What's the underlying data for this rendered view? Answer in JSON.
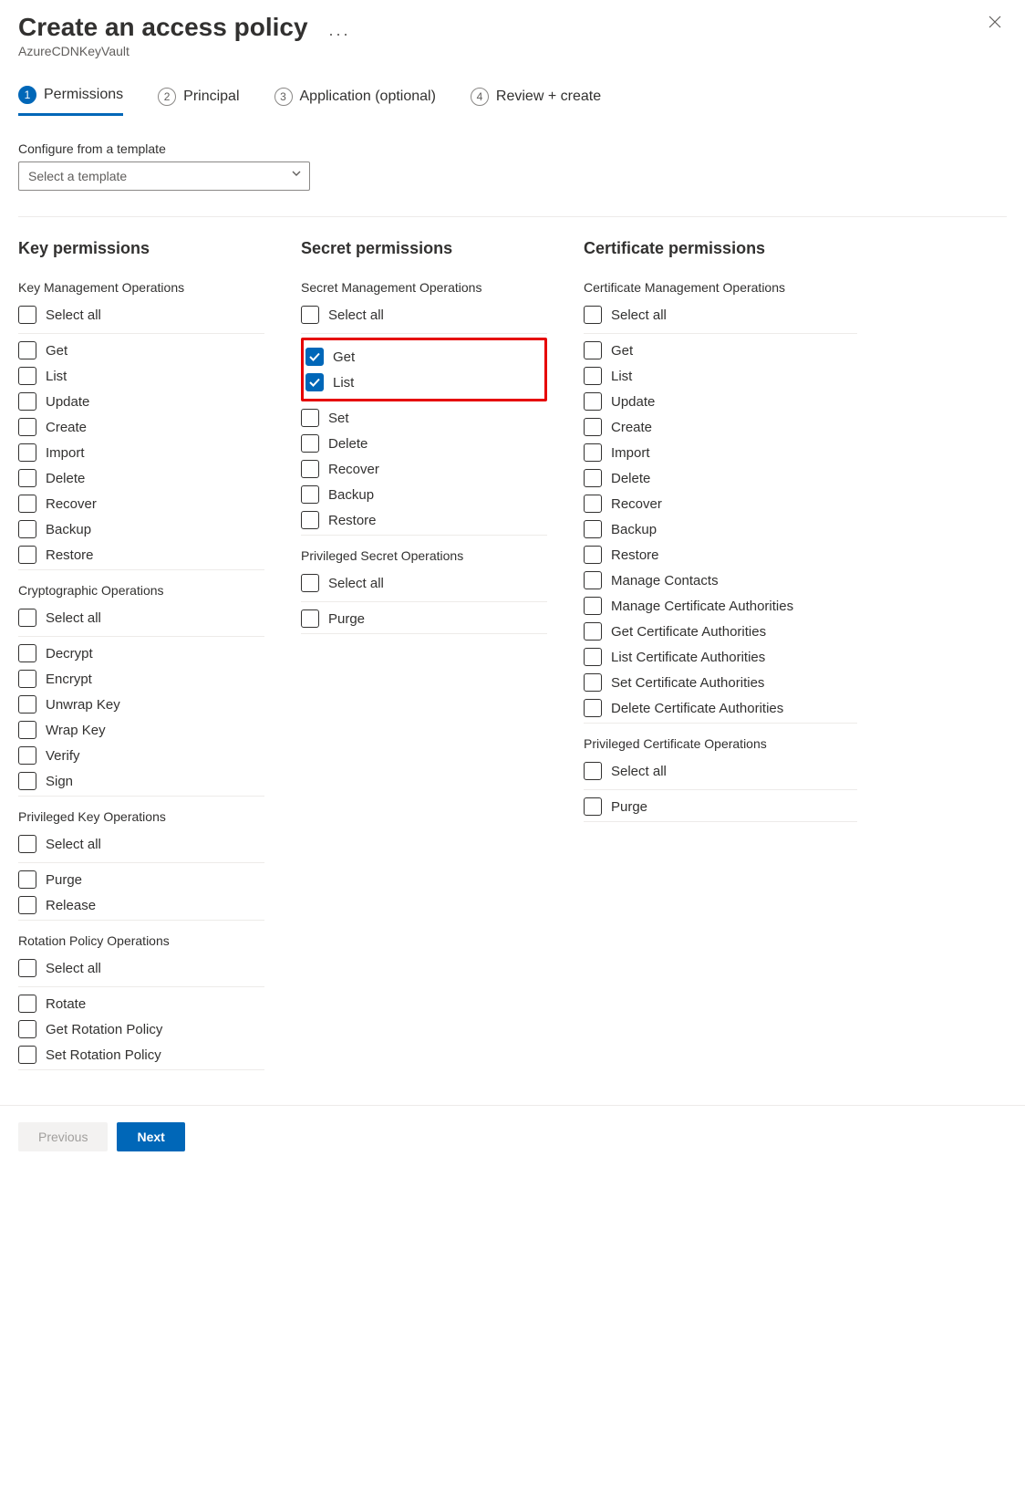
{
  "header": {
    "title": "Create an access policy",
    "subtitle": "AzureCDNKeyVault"
  },
  "tabs": [
    {
      "num": "1",
      "label": "Permissions",
      "active": true
    },
    {
      "num": "2",
      "label": "Principal",
      "active": false
    },
    {
      "num": "3",
      "label": "Application (optional)",
      "active": false
    },
    {
      "num": "4",
      "label": "Review + create",
      "active": false
    }
  ],
  "template": {
    "label": "Configure from a template",
    "placeholder": "Select a template"
  },
  "columns": [
    {
      "title": "Key permissions",
      "sections": [
        {
          "label": "Key Management Operations",
          "select_all": "Select all",
          "items": [
            {
              "label": "Get",
              "checked": false
            },
            {
              "label": "List",
              "checked": false
            },
            {
              "label": "Update",
              "checked": false
            },
            {
              "label": "Create",
              "checked": false
            },
            {
              "label": "Import",
              "checked": false
            },
            {
              "label": "Delete",
              "checked": false
            },
            {
              "label": "Recover",
              "checked": false
            },
            {
              "label": "Backup",
              "checked": false
            },
            {
              "label": "Restore",
              "checked": false
            }
          ]
        },
        {
          "label": "Cryptographic Operations",
          "select_all": "Select all",
          "items": [
            {
              "label": "Decrypt",
              "checked": false
            },
            {
              "label": "Encrypt",
              "checked": false
            },
            {
              "label": "Unwrap Key",
              "checked": false
            },
            {
              "label": "Wrap Key",
              "checked": false
            },
            {
              "label": "Verify",
              "checked": false
            },
            {
              "label": "Sign",
              "checked": false
            }
          ]
        },
        {
          "label": "Privileged Key Operations",
          "select_all": "Select all",
          "items": [
            {
              "label": "Purge",
              "checked": false
            },
            {
              "label": "Release",
              "checked": false
            }
          ]
        },
        {
          "label": "Rotation Policy Operations",
          "select_all": "Select all",
          "items": [
            {
              "label": "Rotate",
              "checked": false
            },
            {
              "label": "Get Rotation Policy",
              "checked": false
            },
            {
              "label": "Set Rotation Policy",
              "checked": false
            }
          ]
        }
      ]
    },
    {
      "title": "Secret permissions",
      "sections": [
        {
          "label": "Secret Management Operations",
          "select_all": "Select all",
          "highlight": [
            0,
            1
          ],
          "items": [
            {
              "label": "Get",
              "checked": true
            },
            {
              "label": "List",
              "checked": true
            },
            {
              "label": "Set",
              "checked": false
            },
            {
              "label": "Delete",
              "checked": false
            },
            {
              "label": "Recover",
              "checked": false
            },
            {
              "label": "Backup",
              "checked": false
            },
            {
              "label": "Restore",
              "checked": false
            }
          ]
        },
        {
          "label": "Privileged Secret Operations",
          "select_all": "Select all",
          "items": [
            {
              "label": "Purge",
              "checked": false
            }
          ]
        }
      ]
    },
    {
      "title": "Certificate permissions",
      "sections": [
        {
          "label": "Certificate Management Operations",
          "select_all": "Select all",
          "items": [
            {
              "label": "Get",
              "checked": false
            },
            {
              "label": "List",
              "checked": false
            },
            {
              "label": "Update",
              "checked": false
            },
            {
              "label": "Create",
              "checked": false
            },
            {
              "label": "Import",
              "checked": false
            },
            {
              "label": "Delete",
              "checked": false
            },
            {
              "label": "Recover",
              "checked": false
            },
            {
              "label": "Backup",
              "checked": false
            },
            {
              "label": "Restore",
              "checked": false
            },
            {
              "label": "Manage Contacts",
              "checked": false
            },
            {
              "label": "Manage Certificate Authorities",
              "checked": false
            },
            {
              "label": "Get Certificate Authorities",
              "checked": false
            },
            {
              "label": "List Certificate Authorities",
              "checked": false
            },
            {
              "label": "Set Certificate Authorities",
              "checked": false
            },
            {
              "label": "Delete Certificate Authorities",
              "checked": false
            }
          ]
        },
        {
          "label": "Privileged Certificate Operations",
          "select_all": "Select all",
          "items": [
            {
              "label": "Purge",
              "checked": false
            }
          ]
        }
      ]
    }
  ],
  "footer": {
    "previous": "Previous",
    "next": "Next"
  }
}
